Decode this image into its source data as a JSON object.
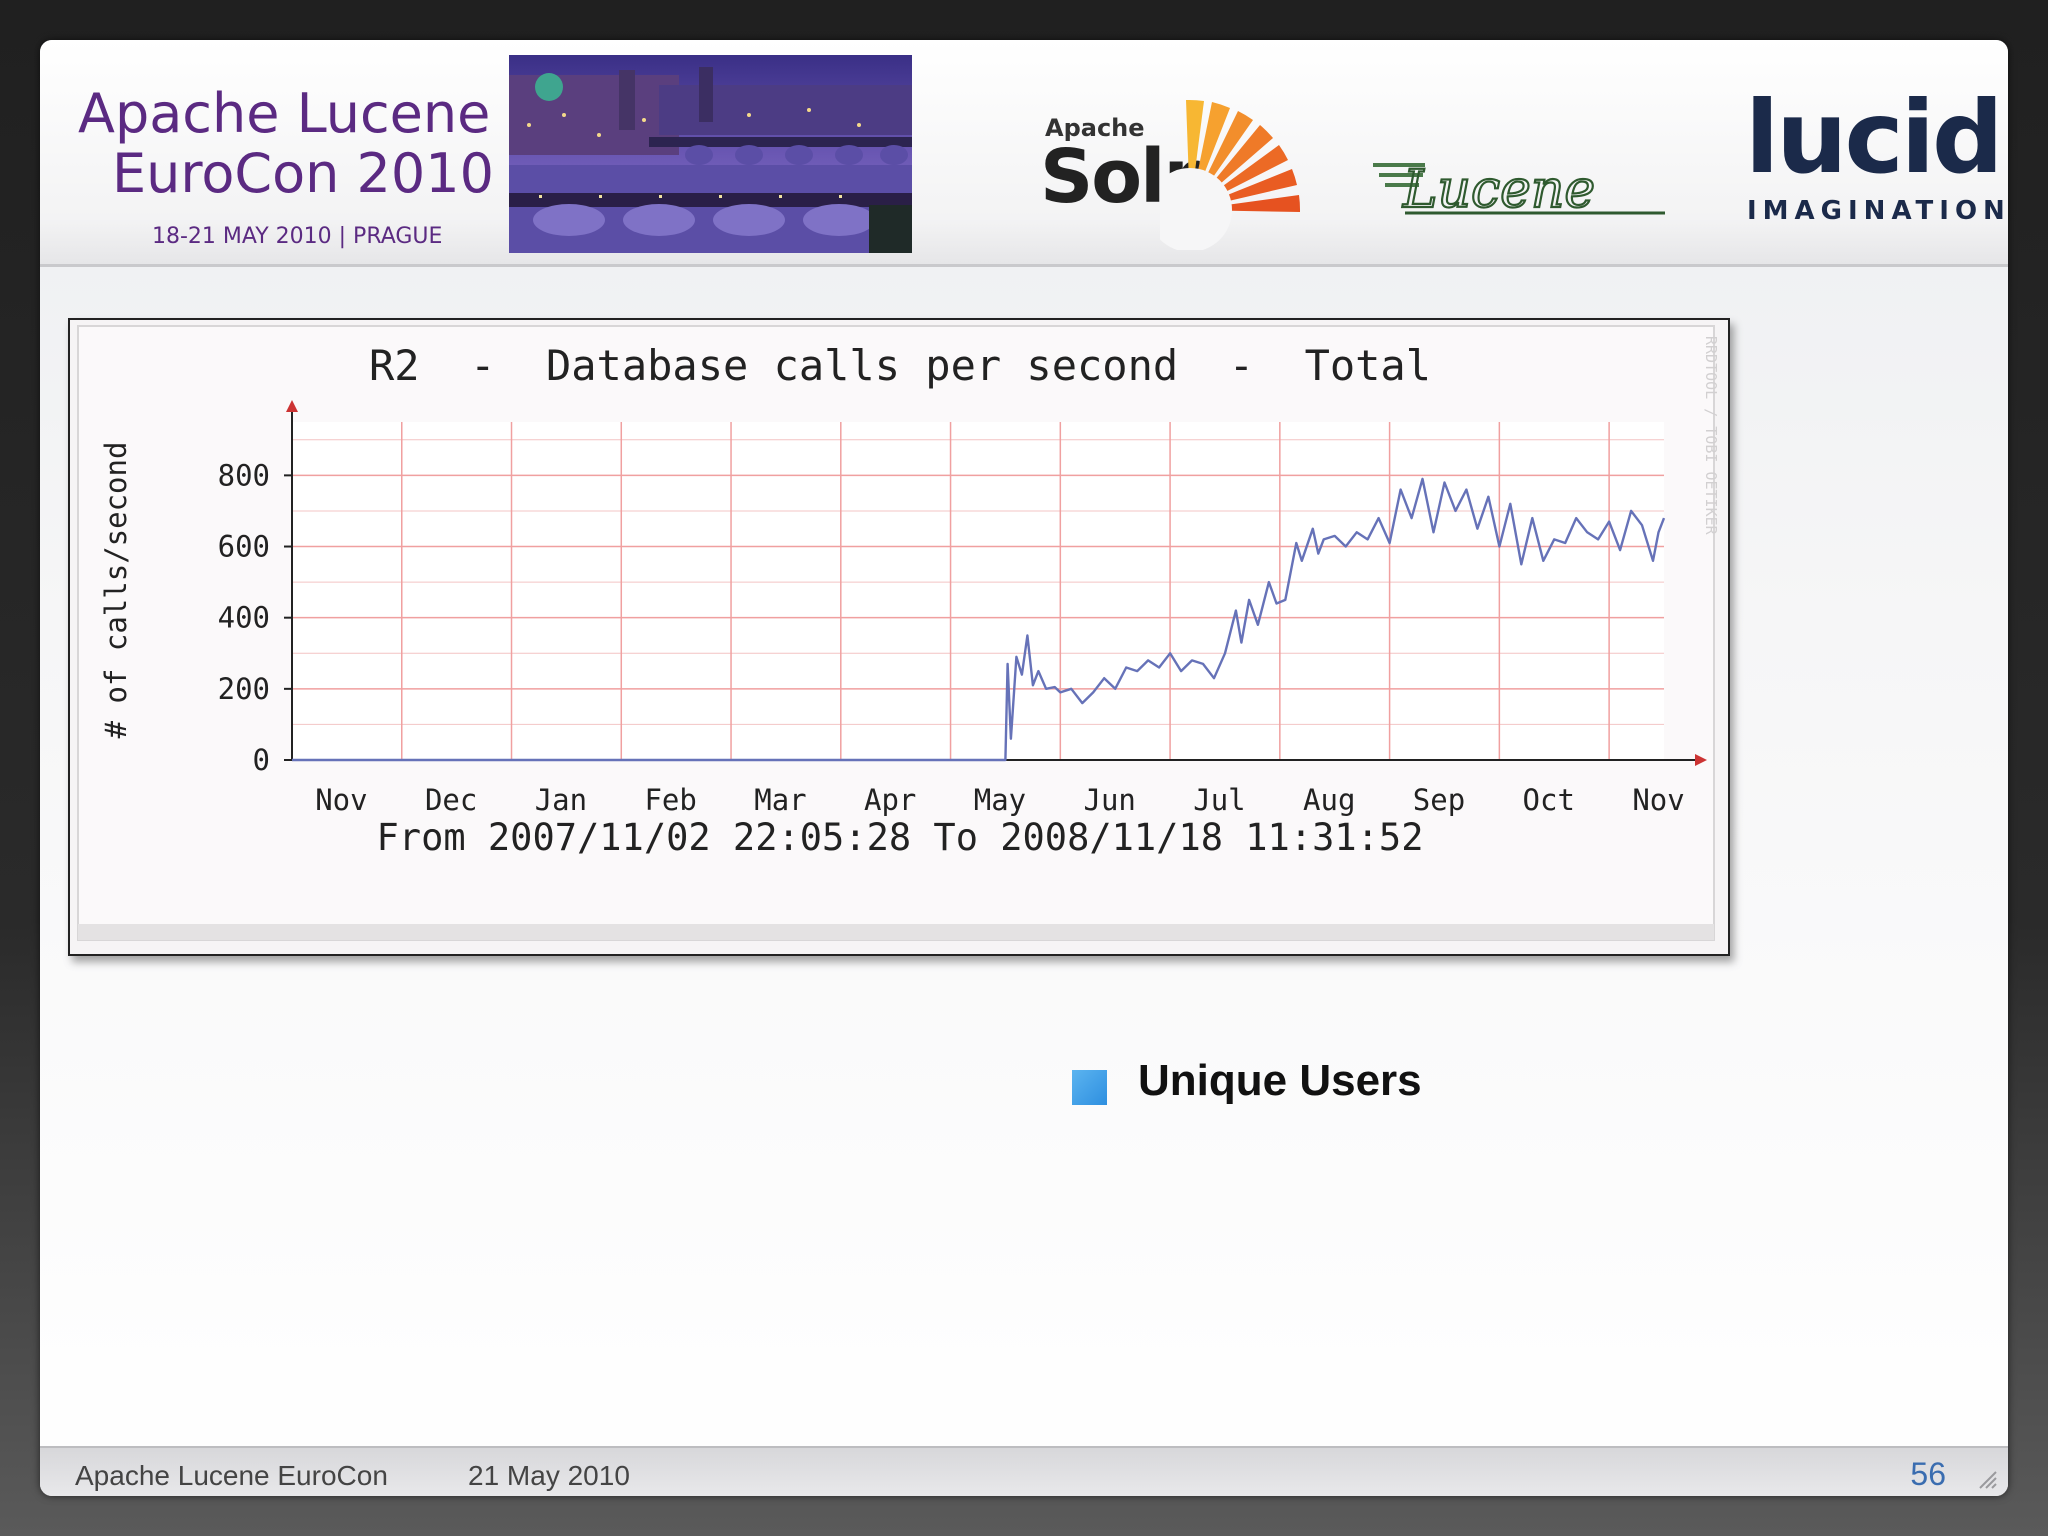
{
  "header": {
    "conference_line1": "Apache Lucene",
    "conference_line2": "EuroCon 2010",
    "conference_dates": "18-21 MAY 2010  |  PRAGUE",
    "photo_icon": "prague-bridges-photo",
    "solr_logo": {
      "top_text": "Apache",
      "word": "Solr"
    },
    "lucene_logo": {
      "word": "Lucene"
    },
    "lucid_logo": {
      "word": "lucid",
      "sub": "IMAGINATION"
    }
  },
  "chart_data": {
    "type": "line",
    "title": "R2  -  Database calls per second  -  Total",
    "ylabel": "# of calls/second",
    "xlabel": "",
    "caption": "From 2007/11/02 22:05:28 To 2008/11/18 11:31:52",
    "watermark": "RRDTOOL / TOBI OETIKER",
    "ylim": [
      0,
      950
    ],
    "y_ticks": [
      "0",
      "200",
      "400",
      "600",
      "800"
    ],
    "x_tick_labels": [
      "Nov",
      "Dec",
      "Jan",
      "Feb",
      "Mar",
      "Apr",
      "May",
      "Jun",
      "Jul",
      "Aug",
      "Sep",
      "Oct",
      "Nov"
    ],
    "x_range_months": [
      0,
      12.5
    ],
    "grid": true,
    "line_color": "#6672b8",
    "grid_color": "#f0a0a0",
    "series": [
      {
        "x": [
          0,
          6.5,
          6.52,
          6.55,
          6.6,
          6.65,
          6.7,
          6.75,
          6.8,
          6.87,
          6.95,
          7.0,
          7.1,
          7.2,
          7.3,
          7.4,
          7.5,
          7.6,
          7.7,
          7.8,
          7.9,
          8.0,
          8.1,
          8.2,
          8.3,
          8.4,
          8.5,
          8.6,
          8.65,
          8.72,
          8.8,
          8.9,
          8.97,
          9.05,
          9.15,
          9.2,
          9.3,
          9.35,
          9.4,
          9.5,
          9.6,
          9.7,
          9.8,
          9.9,
          10.0,
          10.1,
          10.2,
          10.3,
          10.4,
          10.5,
          10.6,
          10.7,
          10.8,
          10.9,
          11.0,
          11.1,
          11.2,
          11.3,
          11.4,
          11.5,
          11.6,
          11.7,
          11.8,
          11.9,
          12.0,
          12.1,
          12.2,
          12.3,
          12.4,
          12.45,
          12.5
        ],
        "values": [
          0,
          0,
          270,
          60,
          290,
          240,
          350,
          210,
          250,
          200,
          205,
          190,
          200,
          160,
          190,
          230,
          200,
          260,
          250,
          280,
          260,
          300,
          250,
          280,
          270,
          230,
          300,
          420,
          330,
          450,
          380,
          500,
          440,
          450,
          610,
          560,
          650,
          580,
          620,
          630,
          600,
          640,
          620,
          680,
          610,
          760,
          680,
          790,
          640,
          780,
          700,
          760,
          650,
          740,
          600,
          720,
          550,
          680,
          560,
          620,
          610,
          680,
          640,
          620,
          670,
          590,
          700,
          660,
          560,
          640,
          680
        ]
      }
    ]
  },
  "legend": {
    "label": "Unique Users",
    "color": "#3a9ee8"
  },
  "footer": {
    "left_text": "Apache Lucene EuroCon",
    "date_text": "21 May 2010",
    "page_number": "56"
  }
}
